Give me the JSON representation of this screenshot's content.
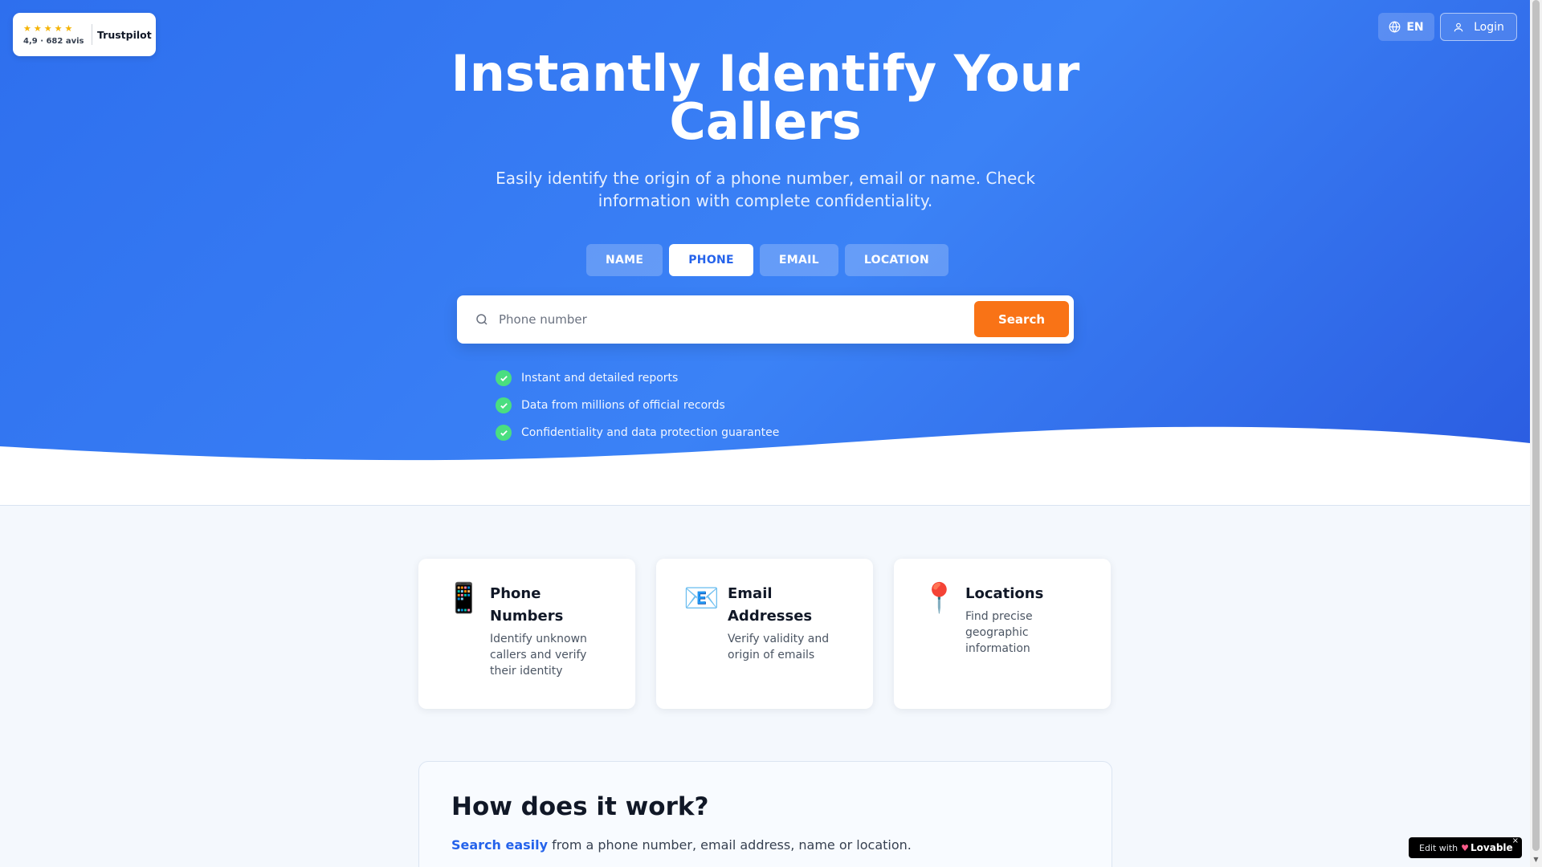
{
  "trustpilot": {
    "stars": "★★★★★",
    "rating": "4,9 · 682 avis",
    "brand": "Trustpilot"
  },
  "header": {
    "language": "EN",
    "login": "Login"
  },
  "hero": {
    "title": "Instantly Identify Your Callers",
    "subtitle": "Easily identify the origin of a phone number, email or name. Check information with complete confidentiality."
  },
  "tabs": [
    {
      "label": "NAME",
      "active": false
    },
    {
      "label": "PHONE",
      "active": true
    },
    {
      "label": "EMAIL",
      "active": false
    },
    {
      "label": "LOCATION",
      "active": false
    }
  ],
  "search": {
    "placeholder": "Phone number",
    "value": "",
    "button": "Search"
  },
  "features": [
    "Instant and detailed reports",
    "Data from millions of official records",
    "Confidentiality and data protection guarantee"
  ],
  "cards": [
    {
      "icon": "📱",
      "icon_name": "mobile-phone-icon",
      "title": "Phone Numbers",
      "description": "Identify unknown callers and verify their identity"
    },
    {
      "icon": "📧",
      "icon_name": "email-icon",
      "title": "Email Addresses",
      "description": "Verify validity and origin of emails"
    },
    {
      "icon": "📍",
      "icon_name": "location-pin-icon",
      "title": "Locations",
      "description": "Find precise geographic information"
    }
  ],
  "how": {
    "title": "How does it work?",
    "highlight": "Search easily",
    "text": " from a phone number, email address, name or location."
  },
  "lovable": {
    "prefix": "Edit with",
    "brand": "Lovable",
    "close": "×"
  },
  "colors": {
    "hero": "#3b82f6",
    "accent": "#f97316",
    "active_tab_text": "#2563eb",
    "check": "#4ade80"
  }
}
